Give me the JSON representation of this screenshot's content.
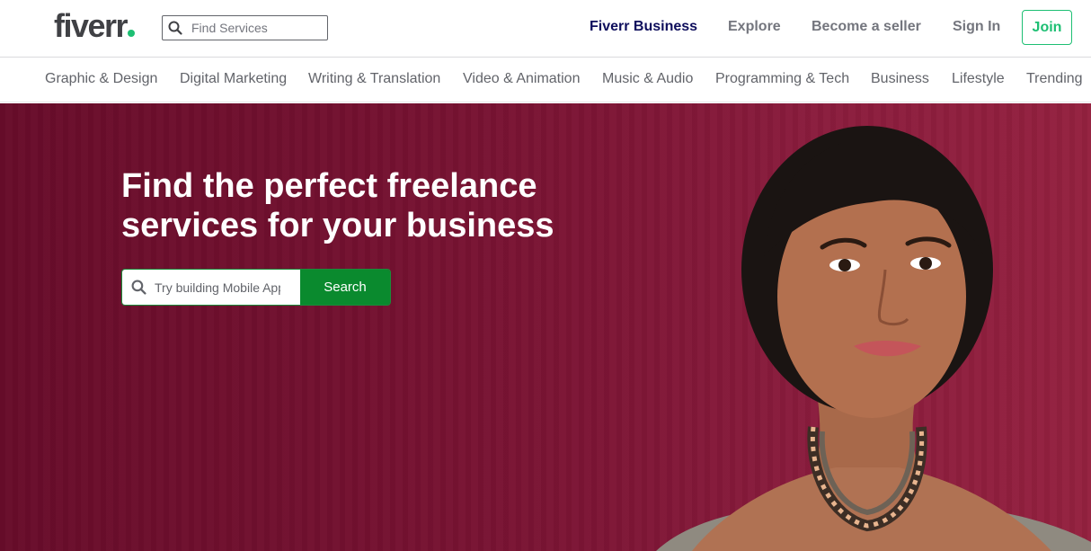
{
  "header": {
    "logo_text": "fiverr",
    "search_placeholder": "Find Services",
    "nav": {
      "business": "Fiverr Business",
      "explore": "Explore",
      "become_seller": "Become a seller",
      "sign_in": "Sign In",
      "join": "Join"
    }
  },
  "categories": [
    "Graphic & Design",
    "Digital Marketing",
    "Writing & Translation",
    "Video & Animation",
    "Music & Audio",
    "Programming & Tech",
    "Business",
    "Lifestyle",
    "Trending"
  ],
  "hero": {
    "title_line1": "Find the perfect freelance",
    "title_line2": "services for your business",
    "search_placeholder": "Try building Mobile App",
    "search_button": "Search"
  },
  "colors": {
    "brand_green": "#1dbf73",
    "hero_bg": "#7d1535",
    "search_button_bg": "#0a8a2e",
    "business_link": "#0e0e5c"
  },
  "icons": {
    "top_search": "search-icon",
    "hero_search": "search-icon"
  }
}
